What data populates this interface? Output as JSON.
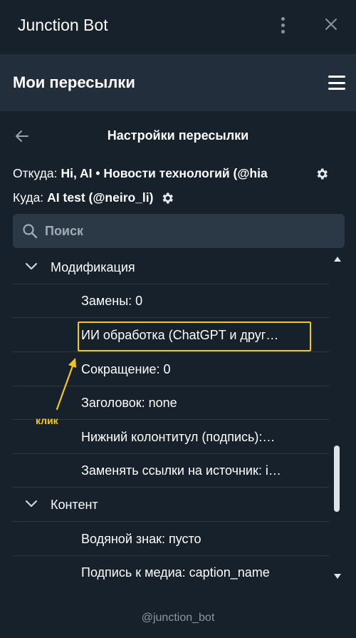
{
  "app": {
    "title": "Junction Bot",
    "accent": "#f5c518"
  },
  "header": {
    "title": "Мои пересылки"
  },
  "screen": {
    "title": "Настройки пересылки"
  },
  "route": {
    "from_label": "Откуда:",
    "from_value": "Hi, AI • Новости технологий (@hia",
    "to_label": "Куда:",
    "to_value": "AI test (@neiro_li)"
  },
  "search": {
    "placeholder": "Поиск"
  },
  "list": {
    "sections": [
      {
        "title": "Модификация",
        "items": [
          "Замены: 0",
          "ИИ обработка (ChatGPT и друг…",
          "Сокращение: 0",
          "Заголовок: none",
          "Нижний колонтитул (подпись):…",
          "Заменять ссылки на источник: i…"
        ]
      },
      {
        "title": "Контент",
        "items": [
          "Водяной знак: пусто",
          "Подпись к медиа: caption_name"
        ]
      }
    ]
  },
  "annotation": {
    "click_label": "клик"
  },
  "footer": {
    "text": "@junction_bot"
  }
}
